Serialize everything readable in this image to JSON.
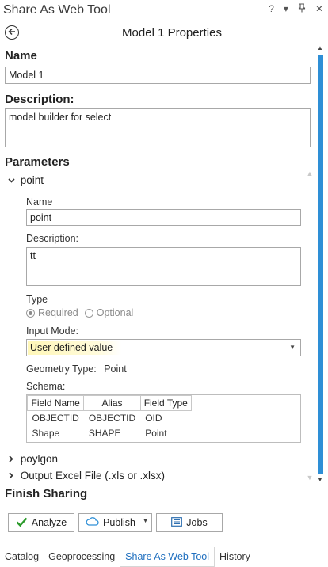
{
  "window": {
    "title": "Share As Web Tool",
    "controls": [
      "?",
      "▾",
      "ᵖ",
      "✕"
    ]
  },
  "header": {
    "title": "Model 1 Properties"
  },
  "name_section": {
    "label": "Name",
    "value": "Model 1"
  },
  "description_section": {
    "label": "Description:",
    "value": "model builder for select"
  },
  "parameters": {
    "label": "Parameters",
    "point": {
      "title": "point",
      "name_label": "Name",
      "name_value": "point",
      "description_label": "Description:",
      "description_value": "tt",
      "type_label": "Type",
      "type_required": "Required",
      "type_optional": "Optional",
      "input_mode_label": "Input Mode:",
      "input_mode_value": "User defined value",
      "geometry_type_label": "Geometry Type:",
      "geometry_type_value": "Point",
      "schema_label": "Schema:",
      "schema": {
        "columns": [
          "Field Name",
          "Alias",
          "Field Type"
        ],
        "rows": [
          [
            "OBJECTID",
            "OBJECTID",
            "OID"
          ],
          [
            "Shape",
            "SHAPE",
            "Point"
          ]
        ]
      }
    },
    "collapsed": [
      {
        "title": "poylgon"
      },
      {
        "title": "Output Excel File (.xls or .xlsx)"
      }
    ]
  },
  "finish_sharing": {
    "label": "Finish Sharing",
    "analyze_label": "Analyze",
    "publish_label": "Publish",
    "jobs_label": "Jobs"
  },
  "tabs": [
    {
      "label": "Catalog",
      "active": false
    },
    {
      "label": "Geoprocessing",
      "active": false
    },
    {
      "label": "Share As Web Tool",
      "active": true
    },
    {
      "label": "History",
      "active": false
    }
  ],
  "colors": {
    "accent": "#2e8fd6",
    "active_tab": "#1f6fbf",
    "highlight": "#fff7b8",
    "check_green": "#2a9a2a"
  }
}
